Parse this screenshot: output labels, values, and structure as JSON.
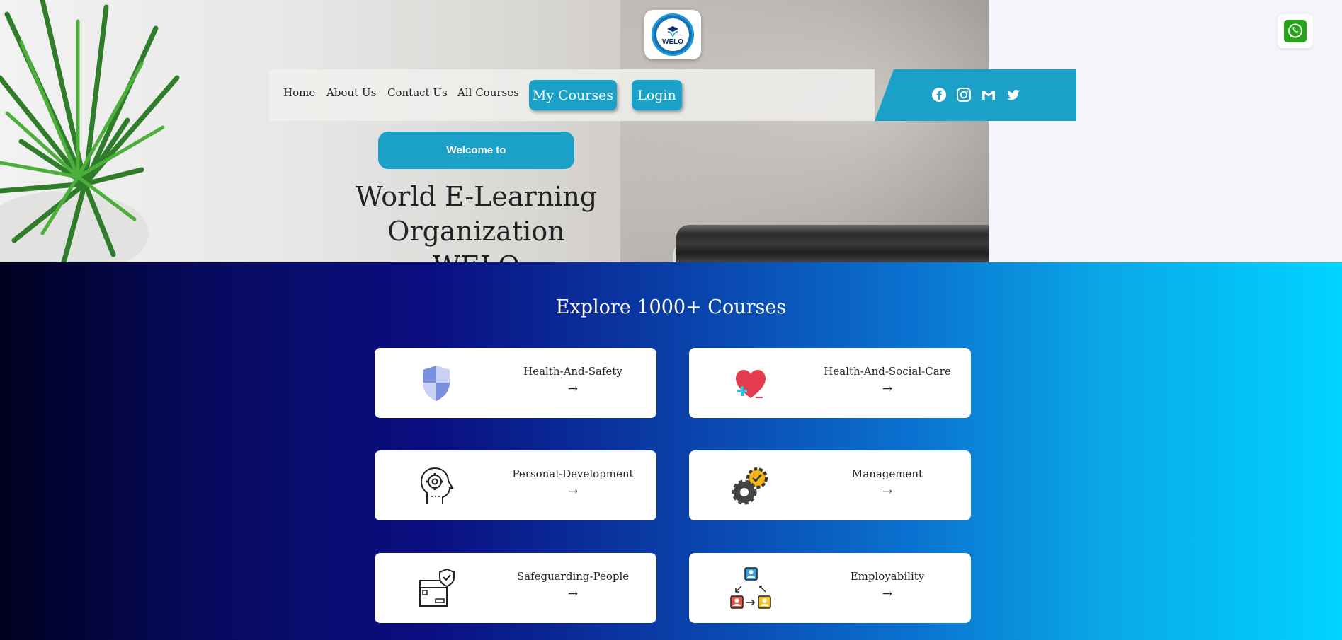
{
  "brand": {
    "logo_text": "WELO"
  },
  "nav": {
    "links": [
      "Home",
      "About Us",
      "Contact Us",
      "All Courses"
    ],
    "my_courses": "My Courses",
    "login": "Login",
    "social_icons": [
      "facebook-icon",
      "instagram-icon",
      "gmail-icon",
      "twitter-icon"
    ]
  },
  "hero": {
    "welcome": "Welcome to",
    "title_line1": "World E-Learning Organization",
    "title_line2": "WELO"
  },
  "courses": {
    "title": "Explore 1000+ Courses",
    "arrow": "→",
    "items": [
      {
        "label": "Health-And-Safety",
        "icon": "shield-icon"
      },
      {
        "label": "Health-And-Social-Care",
        "icon": "heart-plus-icon"
      },
      {
        "label": "Personal-Development",
        "icon": "head-gear-icon"
      },
      {
        "label": "Management",
        "icon": "gears-check-icon"
      },
      {
        "label": "Safeguarding-People",
        "icon": "box-shield-icon"
      },
      {
        "label": "Employability",
        "icon": "people-exchange-icon"
      }
    ]
  },
  "colors": {
    "accent": "#1ba0c8",
    "whatsapp": "#25a41a"
  }
}
